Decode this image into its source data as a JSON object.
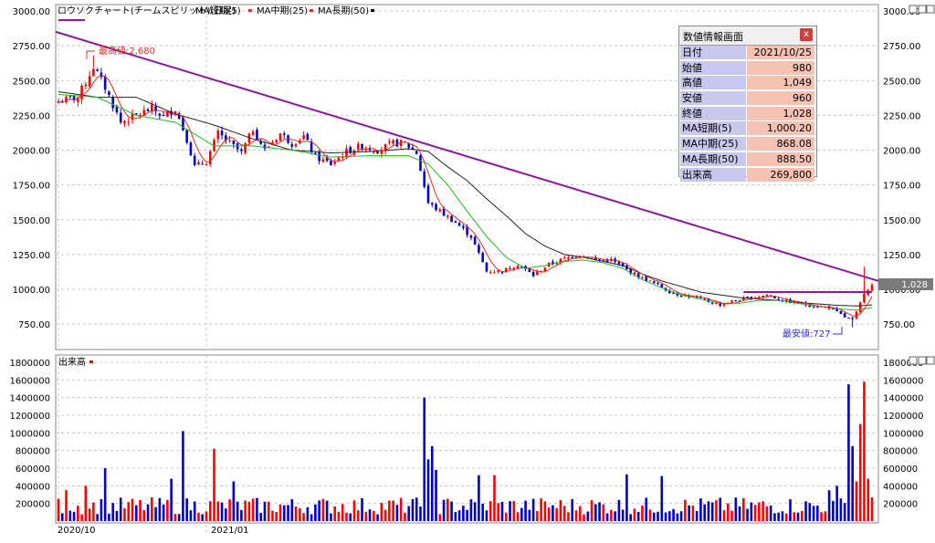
{
  "chart_title": "ロウソクチャート(チームスピリット)(日足)",
  "legend": [
    {
      "label": "MA短期(5)",
      "color": "#e03020"
    },
    {
      "label": "MA中期(25)",
      "color": "#e03020"
    },
    {
      "label": "MA長期(50)",
      "color": "#000000"
    }
  ],
  "volume_title": "出来高",
  "colors": {
    "up": "#ff0000",
    "down": "#0000cc",
    "ma5": "#e03020",
    "ma25": "#22bb22",
    "ma50": "#222222",
    "trendline": "#8b1a9b",
    "grid": "#c8c8c8",
    "price_label_bg": "#7a7a7a"
  },
  "annotations": {
    "high": "最高値:2,680",
    "low": "最安値:727"
  },
  "current_price_label": "1,028",
  "info_panel": {
    "title": "数値情報画面",
    "close": "x",
    "rows": [
      {
        "label": "日付",
        "value": "2021/10/25"
      },
      {
        "label": "始値",
        "value": "980"
      },
      {
        "label": "高値",
        "value": "1,049"
      },
      {
        "label": "安値",
        "value": "960"
      },
      {
        "label": "終値",
        "value": "1,028"
      },
      {
        "label": "MA短期(5)",
        "value": "1,000.20"
      },
      {
        "label": "MA中期(25)",
        "value": "868.08"
      },
      {
        "label": "MA長期(50)",
        "value": "888.50"
      },
      {
        "label": "出来高",
        "value": "269,800"
      }
    ]
  },
  "chart_data": [
    {
      "type": "candlestick",
      "title": "ロウソクチャート(チームスピリット)(日足)",
      "ylim": [
        600,
        3000
      ],
      "y_ticks_left": [
        "3000.00",
        "2750.00",
        "2500.00",
        "2250.00",
        "2000.00",
        "1750.00",
        "1500.00",
        "1250.00",
        "1000.00",
        "750.00"
      ],
      "y_ticks_right": [
        "3000.00",
        "2750.00",
        "2500.00",
        "2250.00",
        "2000.00",
        "1750.00",
        "1500.00",
        "1250.00",
        "1000.00",
        "750.00"
      ],
      "y_tick_values": [
        3000,
        2750,
        2500,
        2250,
        2000,
        1750,
        1500,
        1250,
        1000,
        750
      ],
      "x_labels": [
        "2020/10",
        "2021/01"
      ],
      "x_label_positions": [
        0,
        38
      ],
      "anchors": [
        [
          0,
          2350
        ],
        [
          5,
          2380
        ],
        [
          9,
          2600
        ],
        [
          12,
          2450
        ],
        [
          16,
          2200
        ],
        [
          20,
          2250
        ],
        [
          24,
          2300
        ],
        [
          27,
          2240
        ],
        [
          30,
          2300
        ],
        [
          33,
          2080
        ],
        [
          35,
          1880
        ],
        [
          38,
          1920
        ],
        [
          41,
          2120
        ],
        [
          44,
          2050
        ],
        [
          47,
          1980
        ],
        [
          50,
          2150
        ],
        [
          53,
          2000
        ],
        [
          57,
          2120
        ],
        [
          60,
          2050
        ],
        [
          63,
          2100
        ],
        [
          66,
          1950
        ],
        [
          70,
          1900
        ],
        [
          74,
          1990
        ],
        [
          78,
          2030
        ],
        [
          82,
          2000
        ],
        [
          86,
          2050
        ],
        [
          89,
          2050
        ],
        [
          92,
          1980
        ],
        [
          95,
          1620
        ],
        [
          98,
          1560
        ],
        [
          102,
          1480
        ],
        [
          106,
          1380
        ],
        [
          110,
          1130
        ],
        [
          114,
          1130
        ],
        [
          118,
          1180
        ],
        [
          122,
          1100
        ],
        [
          126,
          1180
        ],
        [
          130,
          1220
        ],
        [
          134,
          1250
        ],
        [
          138,
          1210
        ],
        [
          142,
          1210
        ],
        [
          146,
          1140
        ],
        [
          150,
          1080
        ],
        [
          154,
          1030
        ],
        [
          158,
          970
        ],
        [
          162,
          950
        ],
        [
          166,
          920
        ],
        [
          170,
          890
        ],
        [
          174,
          920
        ],
        [
          178,
          940
        ],
        [
          182,
          960
        ],
        [
          186,
          920
        ],
        [
          190,
          900
        ],
        [
          194,
          880
        ],
        [
          198,
          870
        ],
        [
          202,
          800
        ],
        [
          204,
          780
        ],
        [
          205,
          830
        ],
        [
          206,
          900
        ],
        [
          207,
          980
        ],
        [
          208,
          1005
        ],
        [
          209,
          1028
        ]
      ],
      "ma25_anchors": [
        [
          0,
          2400
        ],
        [
          10,
          2380
        ],
        [
          20,
          2250
        ],
        [
          30,
          2200
        ],
        [
          40,
          2030
        ],
        [
          50,
          2030
        ],
        [
          60,
          2000
        ],
        [
          70,
          1950
        ],
        [
          80,
          1960
        ],
        [
          90,
          1960
        ],
        [
          95,
          1900
        ],
        [
          100,
          1750
        ],
        [
          105,
          1560
        ],
        [
          110,
          1380
        ],
        [
          115,
          1230
        ],
        [
          120,
          1150
        ],
        [
          125,
          1170
        ],
        [
          130,
          1200
        ],
        [
          135,
          1210
        ],
        [
          140,
          1190
        ],
        [
          145,
          1150
        ],
        [
          150,
          1070
        ],
        [
          155,
          1010
        ],
        [
          160,
          960
        ],
        [
          165,
          930
        ],
        [
          170,
          900
        ],
        [
          175,
          900
        ],
        [
          180,
          920
        ],
        [
          185,
          920
        ],
        [
          190,
          900
        ],
        [
          195,
          880
        ],
        [
          200,
          860
        ],
        [
          205,
          850
        ],
        [
          209,
          868
        ]
      ],
      "ma50_anchors": [
        [
          0,
          2420
        ],
        [
          10,
          2380
        ],
        [
          20,
          2380
        ],
        [
          30,
          2260
        ],
        [
          40,
          2180
        ],
        [
          50,
          2080
        ],
        [
          60,
          2000
        ],
        [
          70,
          1980
        ],
        [
          80,
          1990
        ],
        [
          90,
          2010
        ],
        [
          95,
          1990
        ],
        [
          100,
          1880
        ],
        [
          105,
          1780
        ],
        [
          110,
          1650
        ],
        [
          115,
          1530
        ],
        [
          120,
          1400
        ],
        [
          125,
          1310
        ],
        [
          130,
          1250
        ],
        [
          135,
          1230
        ],
        [
          140,
          1200
        ],
        [
          145,
          1170
        ],
        [
          150,
          1110
        ],
        [
          155,
          1060
        ],
        [
          160,
          1020
        ],
        [
          165,
          980
        ],
        [
          170,
          960
        ],
        [
          175,
          940
        ],
        [
          180,
          930
        ],
        [
          185,
          920
        ],
        [
          190,
          905
        ],
        [
          195,
          895
        ],
        [
          200,
          885
        ],
        [
          205,
          880
        ],
        [
          209,
          888
        ]
      ],
      "trendline": {
        "x0": 0,
        "y0": 2850,
        "x1": 209,
        "y1": 1060
      },
      "resistance": {
        "x0": 176,
        "x1": 209,
        "y": 980
      },
      "current_price": 1028,
      "high": 2680,
      "low": 727
    },
    {
      "type": "bar",
      "title": "出来高",
      "ylim": [
        0,
        1800000
      ],
      "y_ticks_left": [
        "1800000",
        "1600000",
        "1400000",
        "1200000",
        "1000000",
        "800000",
        "600000",
        "400000",
        "200000"
      ],
      "y_ticks_right": [
        "1800000",
        "1600000",
        "1400000",
        "1200000",
        "1000000",
        "800000",
        "600000",
        "400000",
        "200000"
      ],
      "y_tick_values": [
        1800000,
        1600000,
        1400000,
        1200000,
        1000000,
        800000,
        600000,
        400000,
        200000
      ],
      "x_labels": [
        "2020/10",
        "2021/01"
      ],
      "base_volume": 150000,
      "spikes": [
        [
          2,
          350000
        ],
        [
          7,
          400000
        ],
        [
          12,
          600000
        ],
        [
          29,
          480000
        ],
        [
          32,
          1020000
        ],
        [
          40,
          820000
        ],
        [
          45,
          450000
        ],
        [
          94,
          1400000
        ],
        [
          95,
          700000
        ],
        [
          96,
          850000
        ],
        [
          97,
          580000
        ],
        [
          108,
          520000
        ],
        [
          112,
          520000
        ],
        [
          146,
          530000
        ],
        [
          155,
          510000
        ],
        [
          198,
          350000
        ],
        [
          200,
          400000
        ],
        [
          203,
          1550000
        ],
        [
          204,
          850000
        ],
        [
          205,
          450000
        ],
        [
          206,
          1100000
        ],
        [
          207,
          1580000
        ],
        [
          208,
          480000
        ],
        [
          209,
          269800
        ]
      ]
    }
  ]
}
